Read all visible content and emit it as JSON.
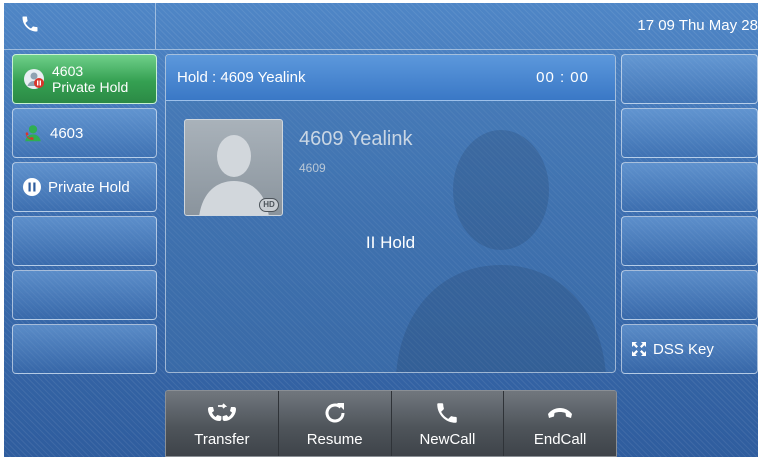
{
  "status_bar": {
    "phone_icon": "phone-icon",
    "datetime": "17 09 Thu May 28"
  },
  "line_keys": [
    {
      "line1": "4603",
      "line2": "Private Hold",
      "icon": "contact-hold-icon",
      "active": true
    },
    {
      "label": "4603",
      "icon": "contact-green-icon",
      "active": false
    },
    {
      "label": "Private Hold",
      "icon": "pause-icon",
      "active": false
    },
    {
      "label": ""
    },
    {
      "label": ""
    },
    {
      "label": ""
    }
  ],
  "call": {
    "header_title": "Hold : 4609 Yealink",
    "timer": "00 : 00",
    "contact_name": "4609 Yealink",
    "contact_number": "4609",
    "hd_badge": "HD",
    "status": "II Hold"
  },
  "dss_keys": [
    {
      "label": ""
    },
    {
      "label": ""
    },
    {
      "label": ""
    },
    {
      "label": ""
    },
    {
      "label": ""
    },
    {
      "label": "DSS Key",
      "icon": "expand-icon"
    }
  ],
  "softkeys": [
    {
      "label": "Transfer",
      "icon": "transfer-icon"
    },
    {
      "label": "Resume",
      "icon": "resume-icon"
    },
    {
      "label": "NewCall",
      "icon": "new-call-icon"
    },
    {
      "label": "EndCall",
      "icon": "end-call-icon"
    }
  ],
  "colors": {
    "screen_blue": "#3f73b2",
    "active_green": "#35a052",
    "softkey_gray": "#4f555b",
    "header_blue": "#3a78c6"
  }
}
